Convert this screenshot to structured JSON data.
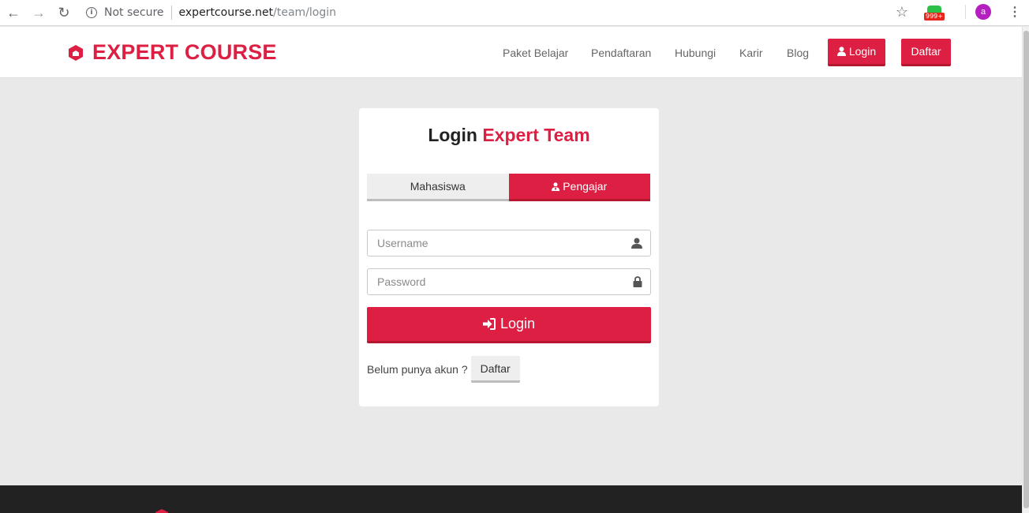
{
  "browser": {
    "security_label": "Not secure",
    "url_host": "expertcourse.net",
    "url_path": "/team/login",
    "extension_badge": "999+",
    "profile_initial": "a"
  },
  "header": {
    "brand": "EXPERT COURSE",
    "nav": [
      {
        "label": "Paket Belajar"
      },
      {
        "label": "Pendaftaran"
      },
      {
        "label": "Hubungi"
      },
      {
        "label": "Karir"
      },
      {
        "label": "Blog"
      }
    ],
    "login_label": "Login",
    "register_label": "Daftar"
  },
  "card": {
    "title_prefix": "Login",
    "title_accent": "Expert Team",
    "tabs": [
      {
        "label": "Mahasiswa",
        "active": false
      },
      {
        "label": "Pengajar",
        "active": true
      }
    ],
    "username_placeholder": "Username",
    "password_placeholder": "Password",
    "submit_label": "Login",
    "register_prompt": "Belum punya akun ?",
    "register_button": "Daftar"
  },
  "colors": {
    "brand": "#dc1f42",
    "page_bg": "#e9e9e9",
    "footer_bg": "#222222"
  }
}
